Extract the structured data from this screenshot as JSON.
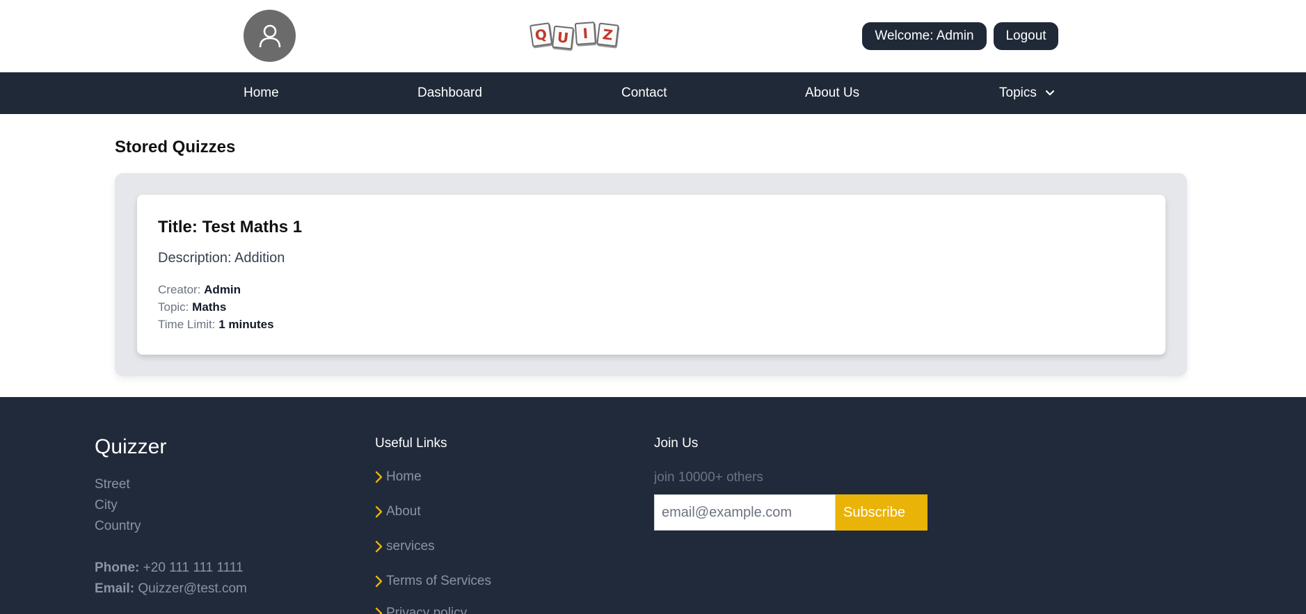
{
  "header": {
    "logo_letters": [
      "Q",
      "U",
      "I",
      "Z"
    ],
    "welcome_label": "Welcome: Admin",
    "logout_label": "Logout"
  },
  "nav": {
    "items": [
      {
        "label": "Home"
      },
      {
        "label": "Dashboard"
      },
      {
        "label": "Contact"
      },
      {
        "label": "About Us"
      },
      {
        "label": "Topics"
      }
    ]
  },
  "main": {
    "section_title": "Stored Quizzes",
    "quiz": {
      "title": "Title: Test Maths 1",
      "description": "Description: Addition",
      "creator_label": "Creator:",
      "creator_value": "Admin",
      "topic_label": "Topic:",
      "topic_value": "Maths",
      "time_limit_label": "Time Limit:",
      "time_limit_value": "1 minutes"
    }
  },
  "footer": {
    "brand": "Quizzer",
    "address": {
      "street": "Street",
      "city": "City",
      "country": "Country"
    },
    "phone_label": "Phone:",
    "phone_value": "+20 111 111 1111",
    "email_label": "Email:",
    "email_value": "Quizzer@test.com",
    "useful_links_title": "Useful Links",
    "links": [
      {
        "label": "Home"
      },
      {
        "label": "About"
      },
      {
        "label": "services"
      },
      {
        "label": "Terms of Services"
      },
      {
        "label": "Privacy policy"
      }
    ],
    "join_title": "Join Us",
    "join_subtitle": "join 10000+ others",
    "email_placeholder": "email@example.com",
    "subscribe_label": "Subscribe"
  },
  "colors": {
    "nav_bg": "#1f2937",
    "footer_bg": "#212a3a",
    "accent": "#eab308",
    "logo_letter": "#c0392b"
  }
}
